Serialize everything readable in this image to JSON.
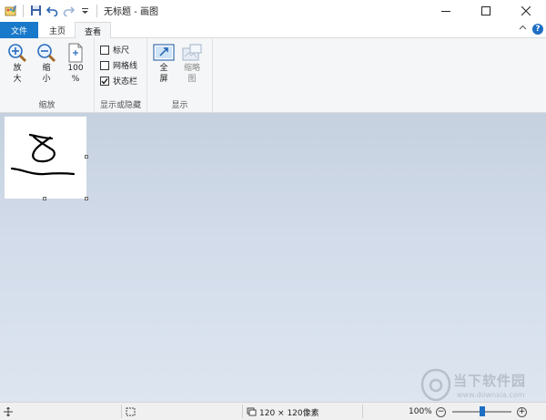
{
  "window": {
    "title": "无标题 - 画图",
    "controls": {
      "minimize_icon": "minimize-icon",
      "maximize_icon": "maximize-icon",
      "close_icon": "close-icon"
    }
  },
  "tabs": [
    {
      "label": "文件",
      "active": false
    },
    {
      "label": "主页",
      "active": false
    },
    {
      "label": "查看",
      "active": true
    }
  ],
  "ribbon": {
    "zoom_group": {
      "label": "缩放",
      "zoom_in": {
        "line1": "放",
        "line2": "大"
      },
      "zoom_out": {
        "line1": "缩",
        "line2": "小"
      },
      "zoom_100": {
        "line1": "100",
        "line2": "%"
      }
    },
    "show_hide_group": {
      "label": "显示或隐藏",
      "rulers": {
        "label": "标尺",
        "checked": false
      },
      "gridlines": {
        "label": "网格线",
        "checked": false
      },
      "status_bar": {
        "label": "状态栏",
        "checked": true
      }
    },
    "display_group": {
      "label": "显示",
      "fullscreen": {
        "line1": "全",
        "line2": "屏"
      },
      "thumbnail": {
        "line1": "缩略",
        "line2": "图"
      }
    }
  },
  "watermark": {
    "title": "当下软件园",
    "url": "www.downxia.com"
  },
  "statusbar": {
    "image_size": "120 × 120像素",
    "zoom_level": "100%",
    "zoom_fraction": 0.5
  },
  "colors": {
    "file_tab": "#1979ca",
    "accent": "#1e6fc4",
    "ribbon_bg": "#f5f6f7",
    "workspace_top": "#c6d1e0",
    "workspace_bottom": "#dde5f0"
  }
}
